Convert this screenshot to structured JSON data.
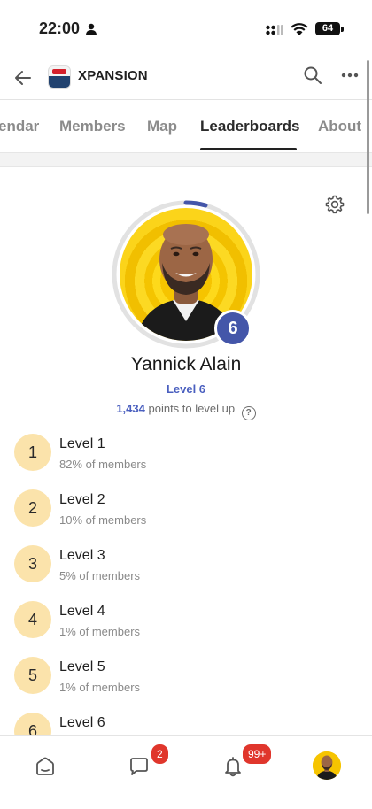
{
  "status_bar": {
    "time": "22:00",
    "battery": "64"
  },
  "header": {
    "title": "XPANSION"
  },
  "tabs": [
    {
      "label": "endar"
    },
    {
      "label": "Members"
    },
    {
      "label": "Map"
    },
    {
      "label": "Leaderboards",
      "active": true
    },
    {
      "label": "About"
    }
  ],
  "profile": {
    "name": "Yannick Alain",
    "level_badge": "6",
    "level_label": "Level 6",
    "points": "1,434",
    "points_suffix": "points to level up",
    "help_glyph": "?"
  },
  "levels": [
    {
      "num": "1",
      "name": "Level 1",
      "pct": "82% of members"
    },
    {
      "num": "2",
      "name": "Level 2",
      "pct": "10% of members"
    },
    {
      "num": "3",
      "name": "Level 3",
      "pct": "5% of members"
    },
    {
      "num": "4",
      "name": "Level 4",
      "pct": "1% of members"
    },
    {
      "num": "5",
      "name": "Level 5",
      "pct": "1% of members"
    },
    {
      "num": "6",
      "name": "Level 6",
      "pct": ""
    }
  ],
  "bottom_nav": {
    "chat_badge": "2",
    "notifications_badge": "99+"
  },
  "colors": {
    "accent": "#4456a9",
    "level_circle": "#fbe3ab",
    "badge_red": "#e0362c",
    "avatar_bg": "#f6c400"
  },
  "icons": [
    "back-arrow-icon",
    "search-icon",
    "more-icon",
    "gear-icon",
    "help-icon",
    "home-icon",
    "chat-icon",
    "bell-icon"
  ]
}
